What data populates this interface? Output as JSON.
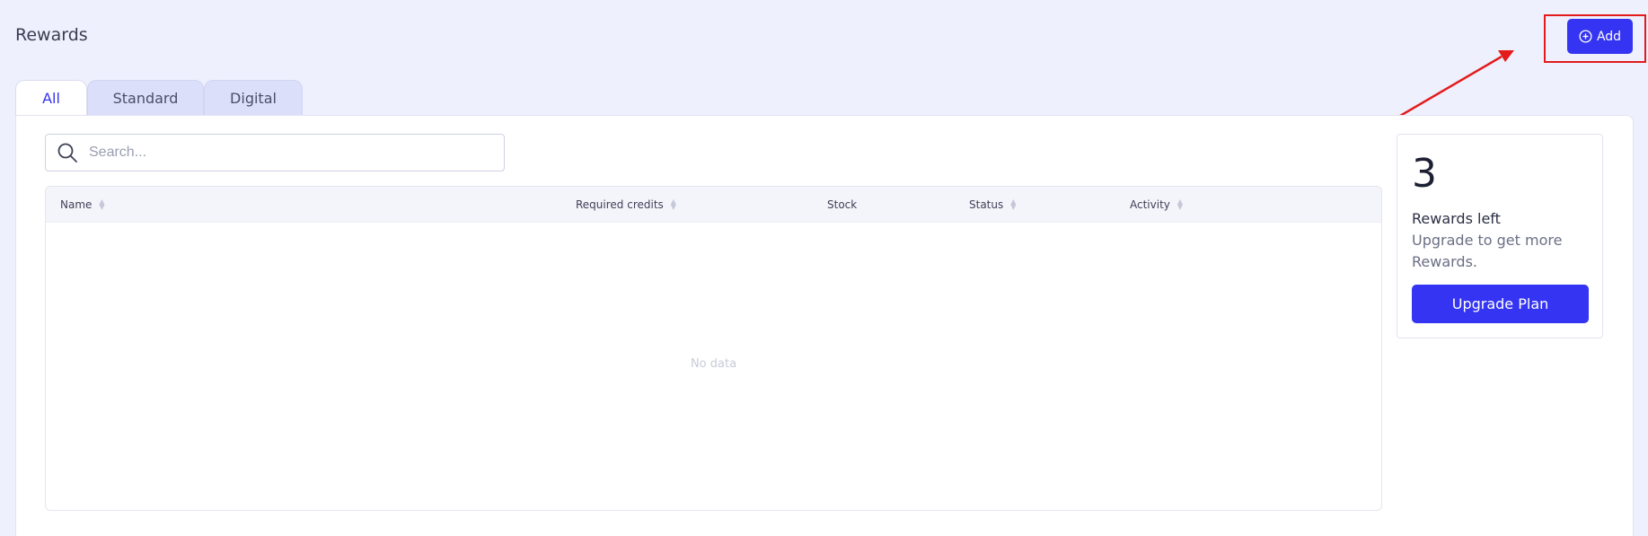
{
  "page": {
    "title": "Rewards"
  },
  "header": {
    "add_label": "Add"
  },
  "tabs": [
    {
      "label": "All",
      "active": true
    },
    {
      "label": "Standard",
      "active": false
    },
    {
      "label": "Digital",
      "active": false
    }
  ],
  "search": {
    "placeholder": "Search...",
    "value": ""
  },
  "table": {
    "columns": [
      {
        "label": "Name",
        "sortable": true
      },
      {
        "label": "Required credits",
        "sortable": true
      },
      {
        "label": "Stock",
        "sortable": false
      },
      {
        "label": "Status",
        "sortable": true
      },
      {
        "label": "Activity",
        "sortable": true
      }
    ],
    "rows": [],
    "empty_text": "No data"
  },
  "rewards_card": {
    "count": "3",
    "label": "Rewards left",
    "description": "Upgrade to get more Rewards.",
    "button_label": "Upgrade Plan"
  },
  "colors": {
    "primary": "#3434f2",
    "background": "#eef0fd",
    "annotation": "#e31b1b"
  }
}
